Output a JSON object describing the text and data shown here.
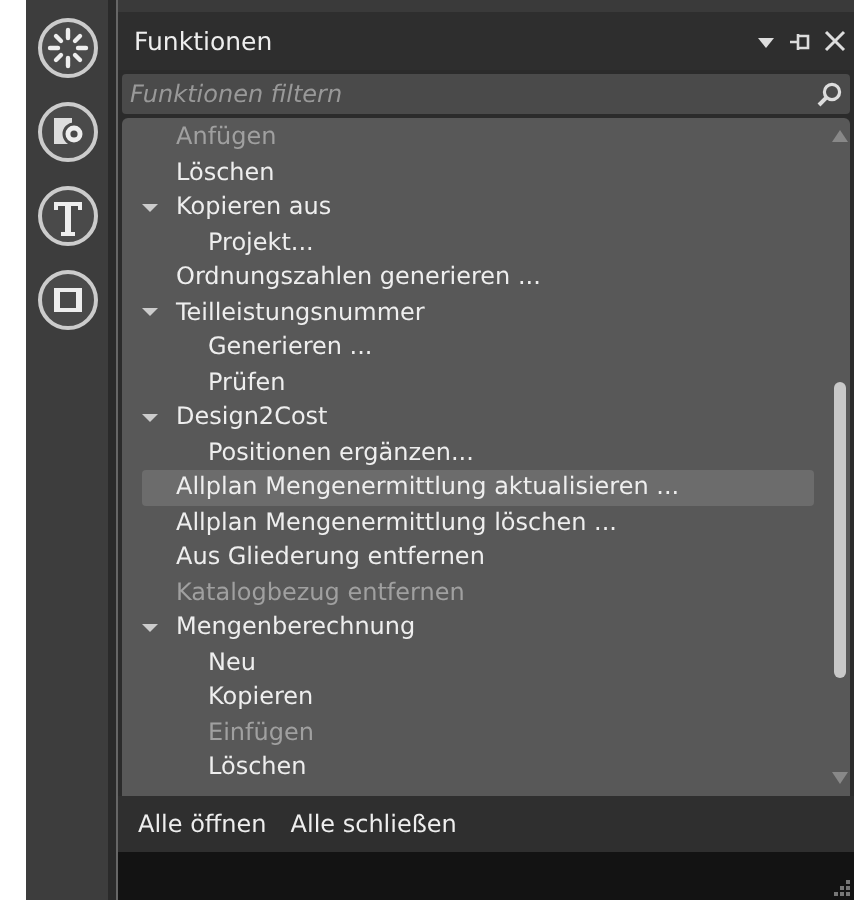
{
  "panel": {
    "title": "Funktionen",
    "filter": {
      "placeholder": "Funktionen filtern"
    },
    "items": [
      {
        "label": "Anfügen",
        "disabled": true,
        "selected": false
      },
      {
        "label": "Löschen",
        "disabled": false,
        "selected": false
      },
      {
        "label": "Kopieren aus",
        "disabled": false,
        "selected": false,
        "expanded": true,
        "children": [
          {
            "label": "Projekt...",
            "disabled": false,
            "selected": false
          }
        ]
      },
      {
        "label": "Ordnungszahlen generieren ...",
        "disabled": false,
        "selected": false
      },
      {
        "label": "Teilleistungsnummer",
        "disabled": false,
        "selected": false,
        "expanded": true,
        "children": [
          {
            "label": "Generieren ...",
            "disabled": false,
            "selected": false
          },
          {
            "label": "Prüfen",
            "disabled": false,
            "selected": false
          }
        ]
      },
      {
        "label": "Design2Cost",
        "disabled": false,
        "selected": false,
        "expanded": true,
        "children": [
          {
            "label": "Positionen ergänzen...",
            "disabled": false,
            "selected": false
          }
        ]
      },
      {
        "label": "Allplan Mengenermittlung aktualisieren ...",
        "disabled": false,
        "selected": true
      },
      {
        "label": "Allplan Mengenermittlung löschen ...",
        "disabled": false,
        "selected": false
      },
      {
        "label": "Aus Gliederung entfernen",
        "disabled": false,
        "selected": false
      },
      {
        "label": "Katalogbezug entfernen",
        "disabled": true,
        "selected": false
      },
      {
        "label": "Mengenberechnung",
        "disabled": false,
        "selected": false,
        "expanded": true,
        "children": [
          {
            "label": "Neu",
            "disabled": false,
            "selected": false
          },
          {
            "label": "Kopieren",
            "disabled": false,
            "selected": false
          },
          {
            "label": "Einfügen",
            "disabled": true,
            "selected": false
          },
          {
            "label": "Löschen",
            "disabled": false,
            "selected": false
          }
        ]
      }
    ],
    "buttons": [
      "Alle öffnen",
      "Alle schließen"
    ]
  }
}
